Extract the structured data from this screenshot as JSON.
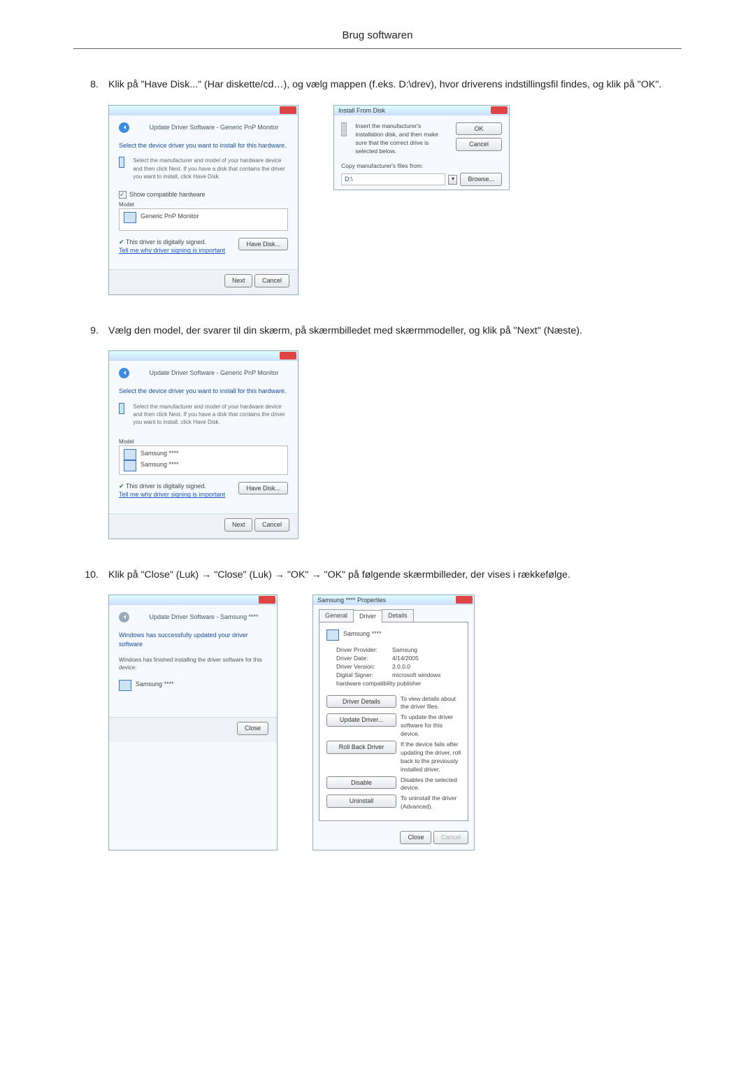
{
  "header": {
    "title": "Brug softwaren"
  },
  "steps": {
    "s8": {
      "num": "8.",
      "text": "Klik på \"Have Disk...\" (Har diskette/cd…), og vælg mappen (f.eks. D:\\drev), hvor driverens indstillingsfil findes, og klik på \"OK\"."
    },
    "s9": {
      "num": "9.",
      "text": "Vælg den model, der svarer til din skærm, på skærmbilledet med skærmmodeller, og klik på \"Next\" (Næste)."
    },
    "s10": {
      "num": "10.",
      "text": "Klik på \"Close\" (Luk) → \"Close\" (Luk) → \"OK\" → \"OK\" på følgende skærmbilleder, der vises i rækkefølge."
    }
  },
  "dlg_update1": {
    "crumb": "Update Driver Software - Generic PnP Monitor",
    "head": "Select the device driver you want to install for this hardware.",
    "sub": "Select the manufacturer and model of your hardware device and then click Next. If you have a disk that contains the driver you want to install, click Have Disk.",
    "chk": "Show compatible hardware",
    "model_hdr": "Model",
    "model1": "Generic PnP Monitor",
    "signed": "This driver is digitally signed.",
    "tell": "Tell me why driver signing is important",
    "havedisk": "Have Disk...",
    "next": "Next",
    "cancel": "Cancel"
  },
  "dlg_install": {
    "title": "Install From Disk",
    "msg": "Insert the manufacturer's installation disk, and then make sure that the correct drive is selected below.",
    "ok": "OK",
    "cancel": "Cancel",
    "copy": "Copy manufacturer's files from:",
    "path": "D:\\",
    "browse": "Browse..."
  },
  "dlg_update2": {
    "crumb": "Update Driver Software - Generic PnP Monitor",
    "head": "Select the device driver you want to install for this hardware.",
    "sub": "Select the manufacturer and model of your hardware device and then click Next. If you have a disk that contains the driver you want to install, click Have Disk.",
    "model_hdr": "Model",
    "model1": "Samsung ****",
    "model2": "Samsung ****",
    "signed": "This driver is digitally signed.",
    "tell": "Tell me why driver signing is important",
    "havedisk": "Have Disk...",
    "next": "Next",
    "cancel": "Cancel"
  },
  "dlg_done": {
    "crumb": "Update Driver Software - Samsung ****",
    "head": "Windows has successfully updated your driver software",
    "sub": "Windows has finished installing the driver software for this device:",
    "device": "Samsung ****",
    "close": "Close"
  },
  "dlg_props": {
    "title": "Samsung **** Properties",
    "tab_general": "General",
    "tab_driver": "Driver",
    "tab_details": "Details",
    "device": "Samsung ****",
    "provider_l": "Driver Provider:",
    "provider_v": "Samsung",
    "date_l": "Driver Date:",
    "date_v": "4/14/2005",
    "ver_l": "Driver Version:",
    "ver_v": "2.0.0.0",
    "signer_l": "Digital Signer:",
    "signer_v": "microsoft windows hardware compatibility publisher",
    "bdet": "Driver Details",
    "tdet": "To view details about the driver files.",
    "bupd": "Update Driver...",
    "tupd": "To update the driver software for this device.",
    "brol": "Roll Back Driver",
    "trol": "If the device fails after updating the driver, roll back to the previously installed driver.",
    "bdis": "Disable",
    "tdis": "Disables the selected device.",
    "buni": "Uninstall",
    "tuni": "To uninstall the driver (Advanced).",
    "close": "Close",
    "cancel": "Cancel"
  }
}
